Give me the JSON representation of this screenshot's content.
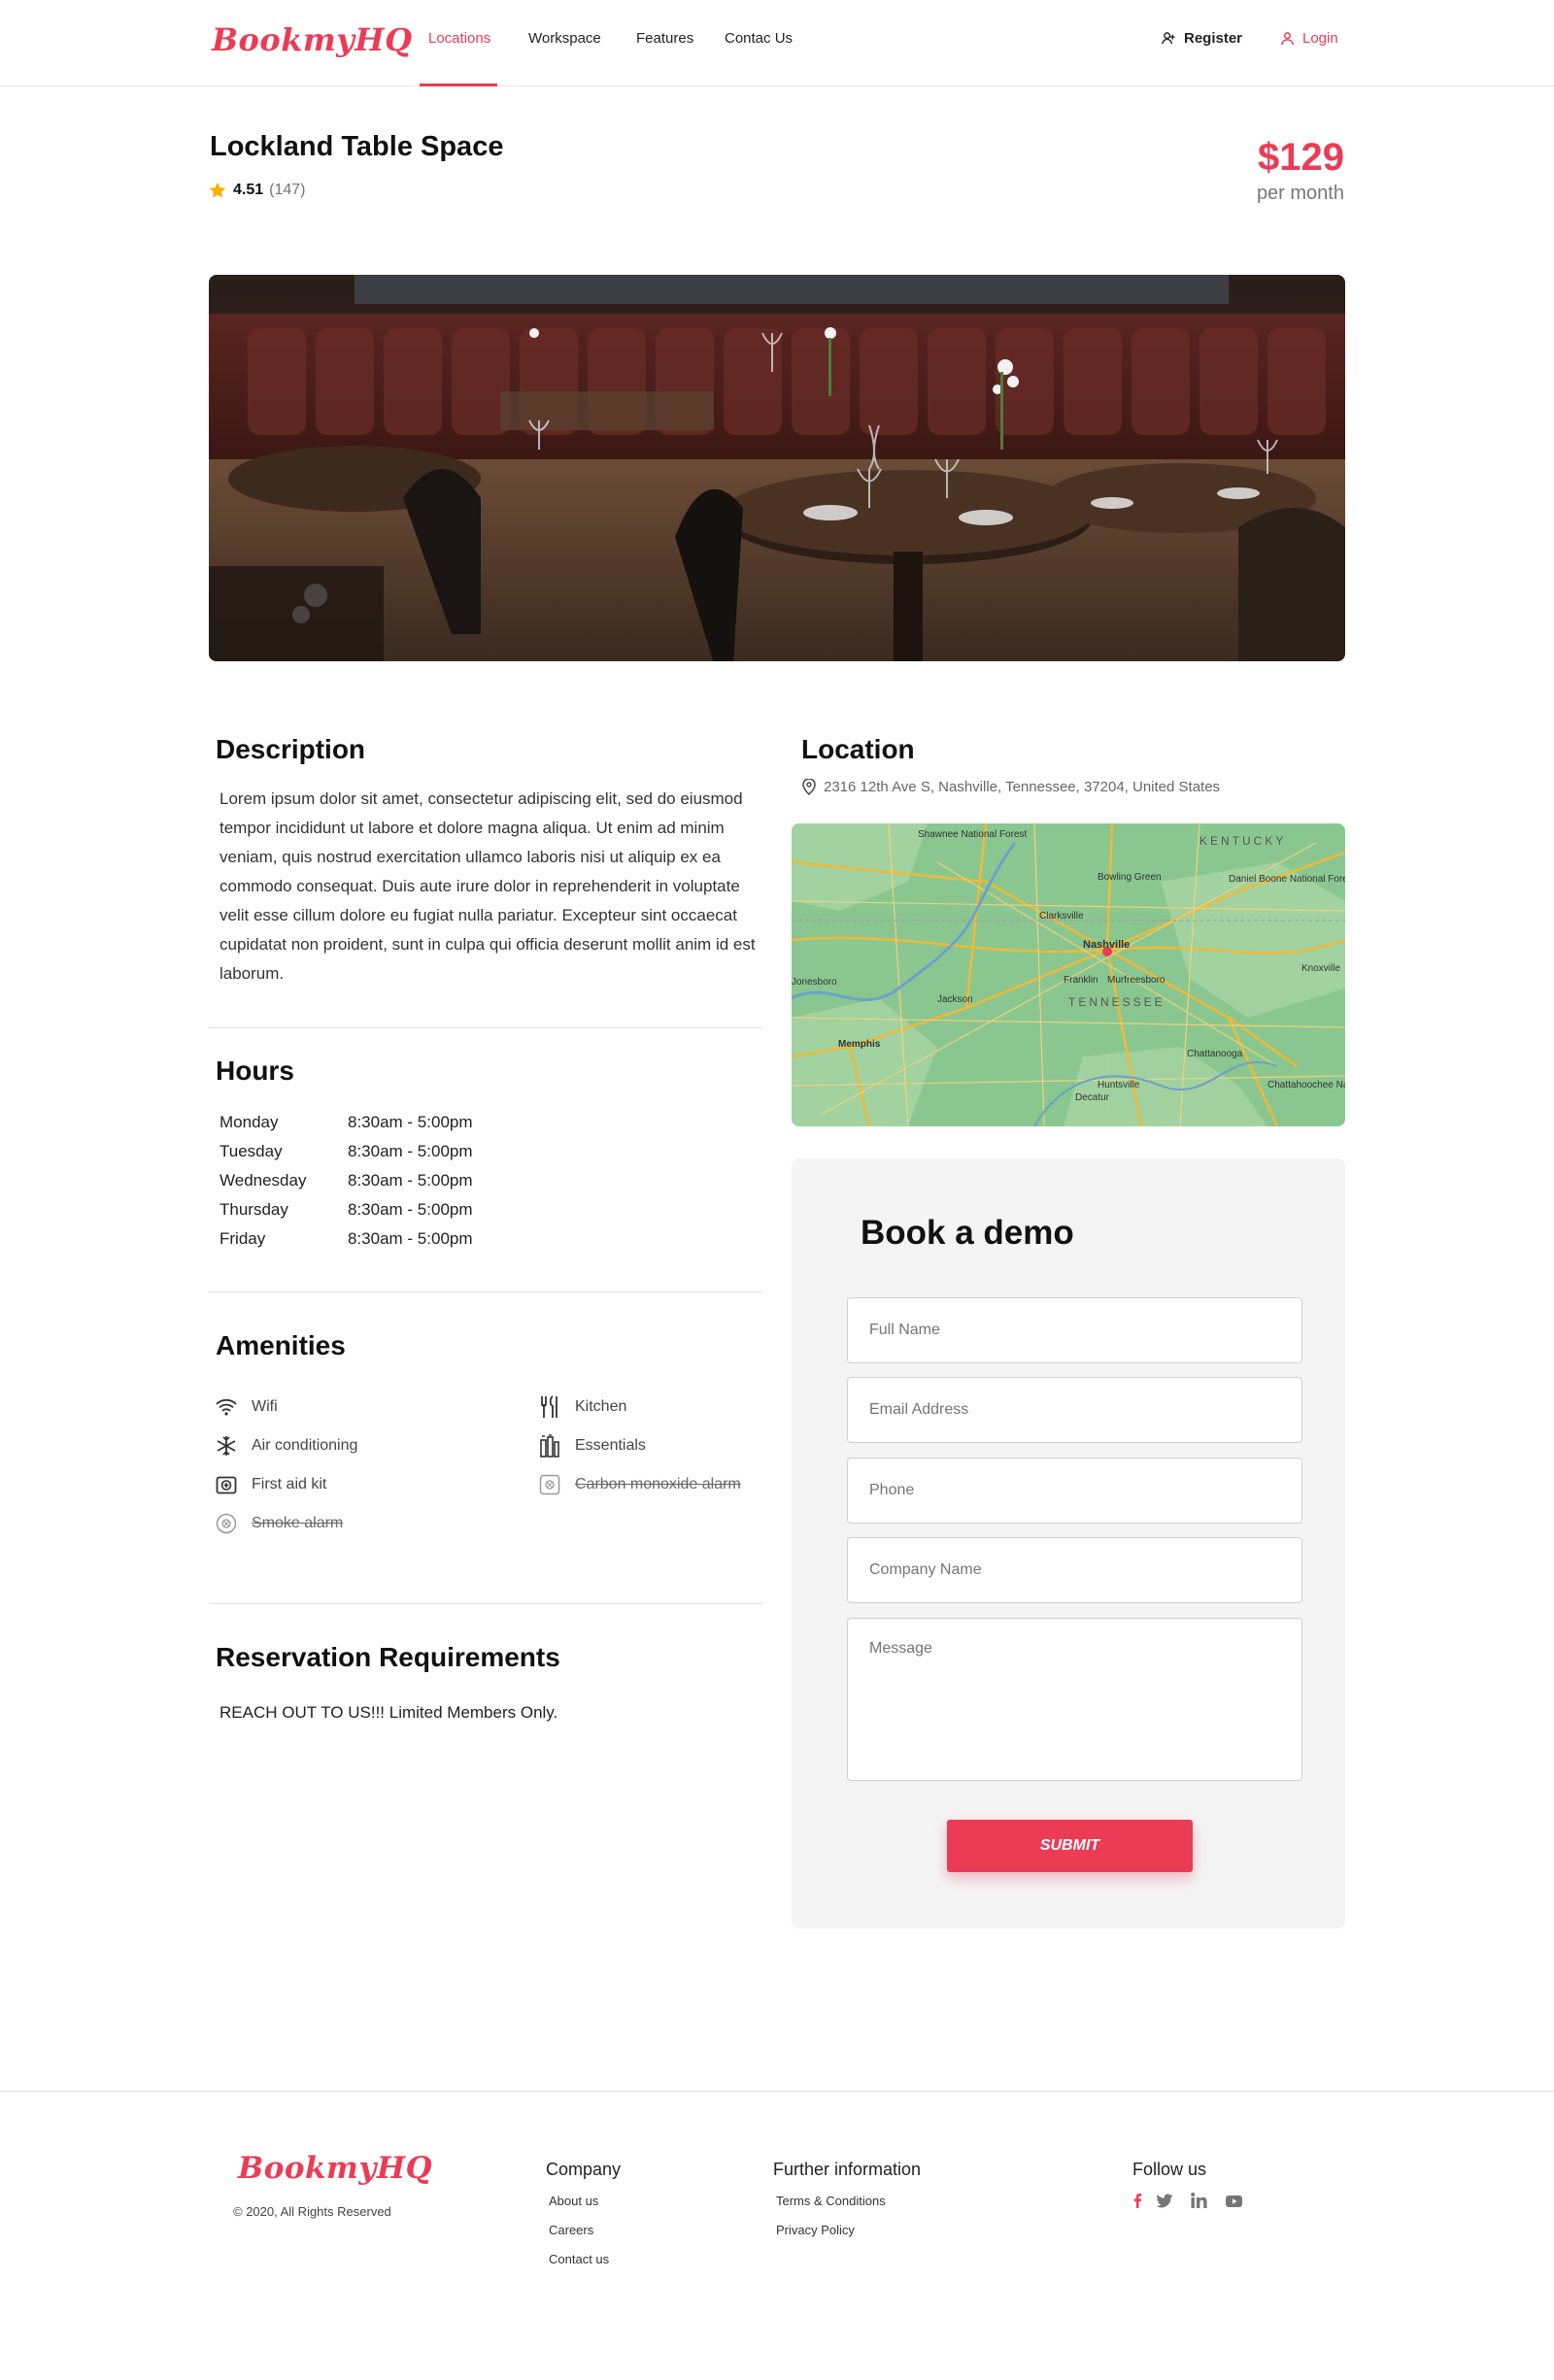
{
  "brand": {
    "logo": "BookmyHQ",
    "accent": "#ec3b54"
  },
  "nav": {
    "links": [
      "Locations",
      "Workspace",
      "Features",
      "Contac Us"
    ],
    "active": "Locations",
    "register": "Register",
    "login": "Login"
  },
  "listing": {
    "title": "Lockland Table  Space",
    "rating": "4.51",
    "reviews": "(147)",
    "price": "$129",
    "price_unit": "per month"
  },
  "description": {
    "heading": "Description",
    "text": "Lorem ipsum dolor sit amet, consectetur adipiscing elit, sed do eiusmod tempor incididunt ut labore et dolore magna aliqua. Ut enim ad minim veniam, quis nostrud exercitation ullamco laboris nisi ut aliquip ex ea commodo consequat. Duis aute irure dolor in reprehenderit in voluptate velit esse cillum dolore eu fugiat nulla pariatur. Excepteur sint occaecat cupidatat non proident, sunt in culpa qui officia deserunt mollit anim id est laborum."
  },
  "hours": {
    "heading": "Hours",
    "rows": [
      {
        "day": "Monday",
        "time": "8:30am - 5:00pm"
      },
      {
        "day": "Tuesday",
        "time": "8:30am - 5:00pm"
      },
      {
        "day": "Wednesday",
        "time": "8:30am - 5:00pm"
      },
      {
        "day": "Thursday",
        "time": "8:30am - 5:00pm"
      },
      {
        "day": "Friday",
        "time": "8:30am - 5:00pm"
      }
    ]
  },
  "amenities": {
    "heading": "Amenities",
    "items": [
      {
        "label": "Wifi",
        "icon": "wifi-icon",
        "available": true
      },
      {
        "label": "Kitchen",
        "icon": "kitchen-icon",
        "available": true
      },
      {
        "label": "Air conditioning",
        "icon": "snowflake-icon",
        "available": true
      },
      {
        "label": "Essentials",
        "icon": "essentials-icon",
        "available": true
      },
      {
        "label": "First aid kit",
        "icon": "first-aid-icon",
        "available": true
      },
      {
        "label": "Carbon monoxide alarm",
        "icon": "co-alarm-icon",
        "available": false
      },
      {
        "label": "Smoke alarm",
        "icon": "smoke-alarm-icon",
        "available": false
      }
    ]
  },
  "requirements": {
    "heading": "Reservation Requirements",
    "text": "REACH OUT TO US!!! Limited Members Only."
  },
  "location": {
    "heading": "Location",
    "address": "2316 12th Ave S, Nashville, Tennessee, 37204, United States",
    "map_labels": [
      "Shawnee National Forest",
      "KENTUCKY",
      "Bowling Green",
      "Daniel Boone National Forest",
      "Clarksville",
      "Nashville",
      "Knoxville",
      "Jonesboro",
      "Jackson",
      "Franklin",
      "Murfreesboro",
      "TENNESSEE",
      "Memphis",
      "Chattanooga",
      "Huntsville",
      "Decatur",
      "Chattahoochee National Forest"
    ]
  },
  "form": {
    "title": "Book a demo",
    "full_name": "Full Name",
    "email": "Email Address",
    "phone": "Phone",
    "company": "Company Name",
    "message": "Message",
    "submit": "SUBMIT"
  },
  "footer": {
    "logo": "BookmyHQ",
    "copyright": "© 2020, All Rights Reserved",
    "company_heading": "Company",
    "company_links": [
      "About us",
      "Careers",
      "Contact us"
    ],
    "info_heading": "Further information",
    "info_links": [
      "Terms & Conditions",
      "Privacy Policy"
    ],
    "follow_heading": "Follow us",
    "social_icons": [
      "facebook-icon",
      "twitter-icon",
      "linkedin-icon",
      "youtube-icon"
    ]
  }
}
